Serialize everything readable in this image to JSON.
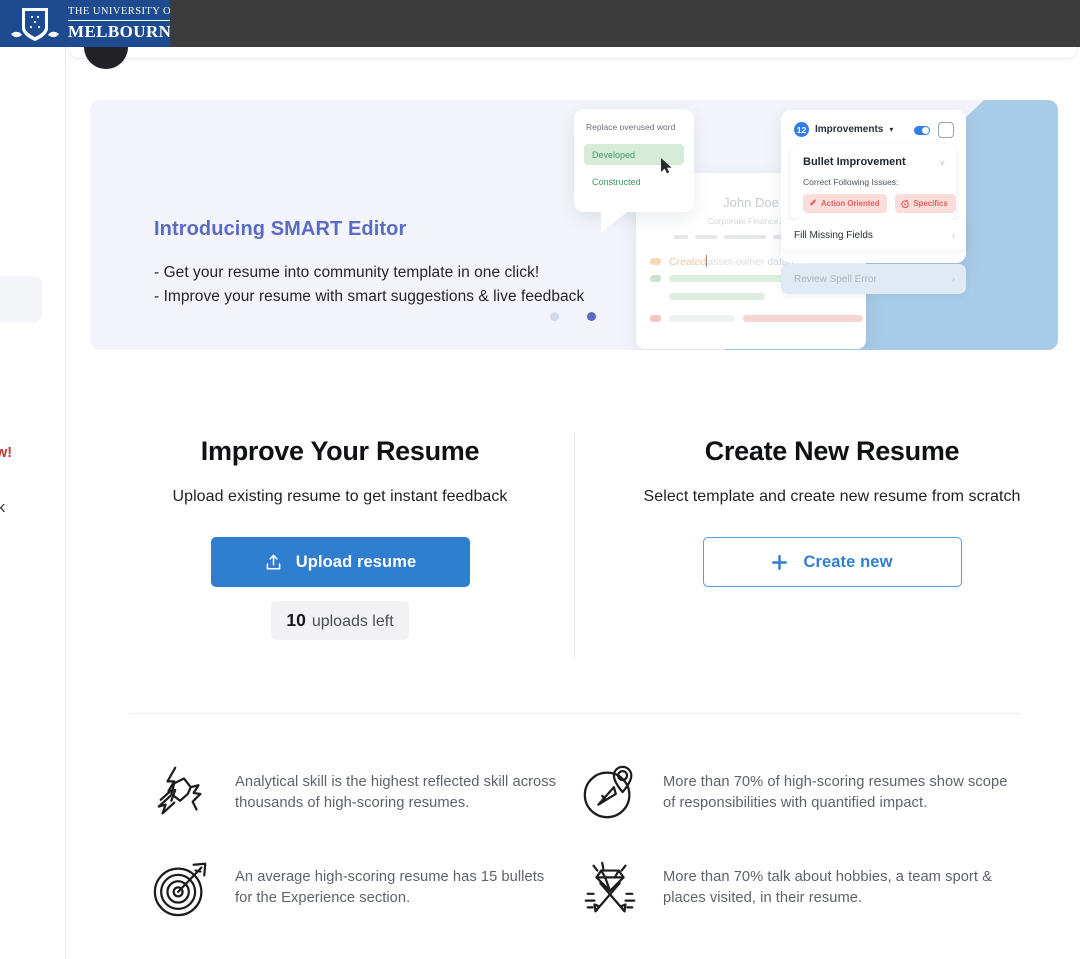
{
  "window": {
    "org_logo": {
      "line1": "THE UNIVERSITY OF",
      "line2": "MELBOURNE",
      "icon": "university-crest-icon"
    }
  },
  "left_gutter": {
    "red_text": "w!",
    "dark_text": "ck"
  },
  "banner": {
    "title": "Introducing SMART Editor",
    "bullets": [
      "- Get your resume into community template in one click!",
      "- Improve your resume with smart suggestions & live feedback"
    ],
    "carousel": {
      "total": 2,
      "active_index": 1
    },
    "colors": {
      "background": "#f3f4fb",
      "title": "#5a6bc4",
      "art_blue": "#a8cbe8"
    },
    "art": {
      "word_popover": {
        "title": "Replace overused word",
        "options": [
          "Developed",
          "Constructed"
        ],
        "selected": "Developed"
      },
      "resume_preview": {
        "name": "John Doe",
        "role": "Corporate Finance Ass",
        "bullet_text": "Created",
        "bullet_text_rest": "asset-owner datab"
      },
      "improvements_panel": {
        "count": "12",
        "title": "Improvements",
        "card_title": "Bullet Improvement",
        "card_subtitle": "Correct Following Issues:",
        "chips": [
          {
            "label": "Action Oriented",
            "icon": "rocket-icon"
          },
          {
            "label": "Specifics",
            "icon": "target-icon"
          }
        ],
        "rows": [
          {
            "label": "Fill Missing Fields",
            "state": "active"
          },
          {
            "label": "Review Spell Error",
            "state": "muted"
          }
        ]
      }
    }
  },
  "main": {
    "improve": {
      "heading": "Improve Your Resume",
      "subtext": "Upload existing resume to get instant feedback",
      "button": {
        "label": "Upload resume",
        "icon": "upload-icon",
        "color": "#2f7ed0"
      },
      "uploads_count": "10",
      "uploads_label": "uploads left"
    },
    "create": {
      "heading": "Create New Resume",
      "subtext": "Select template and create new resume from scratch",
      "button": {
        "label": "Create new",
        "icon": "plus-icon",
        "color": "#2f7ed0"
      }
    }
  },
  "stats": [
    {
      "icon": "lightning-skill-icon",
      "text": "Analytical skill is the highest reflected skill across thousands of high-scoring resumes."
    },
    {
      "icon": "compass-icon",
      "text": "More than 70% of high-scoring resumes show scope of responsibilities with quantified impact."
    },
    {
      "icon": "target-arrow-icon",
      "text": "An average high-scoring resume has 15 bullets for the Experience section."
    },
    {
      "icon": "diamond-pencils-icon",
      "text": "More than 70% talk about hobbies, a team sport & places visited, in their resume."
    }
  ]
}
